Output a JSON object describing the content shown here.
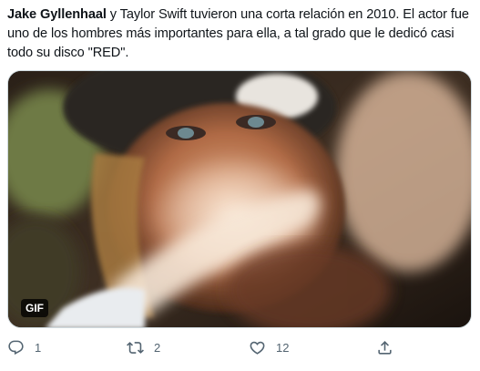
{
  "tweet": {
    "author_mention": "Jake Gyllenhaal",
    "text_rest": " y Taylor Swift tuvieron una corta relación en 2010. El actor fue uno de los hombres más importantes para ella, a tal grado que le dedicó casi todo su disco \"RED\"."
  },
  "media": {
    "badge": "GIF"
  },
  "actions": {
    "reply_count": "1",
    "retweet_count": "2",
    "like_count": "12"
  },
  "icons": {
    "reply": "reply-icon",
    "retweet": "retweet-icon",
    "like": "heart-icon",
    "share": "share-icon"
  },
  "colors": {
    "text": "#0f1419",
    "secondary": "#536471",
    "border": "#cfd9de"
  }
}
